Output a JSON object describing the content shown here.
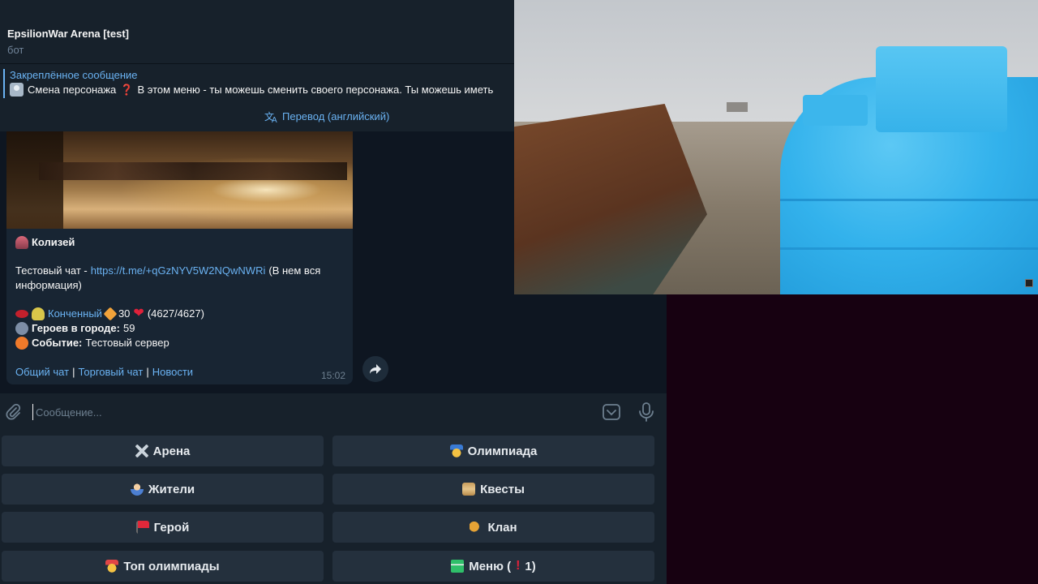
{
  "chat": {
    "title": "EpsilionWar Arena [test]",
    "status": "бот"
  },
  "pinned": {
    "title": "Закреплённое сообщение",
    "label": "Смена персонажа",
    "text": "В этом меню - ты можешь сменить своего персонажа. Ты можешь иметь"
  },
  "translate": {
    "label": "Перевод (английский)"
  },
  "message": {
    "location": "Колизей",
    "test_chat_label": "Тестовый чат - ",
    "test_chat_link": "https://t.me/+qGzNYV5W2NQwNWRi",
    "test_chat_note": " (В нем вся",
    "test_chat_note2": "информация)",
    "player_name": "Конченный",
    "level": "30",
    "hp": "(4627/4627)",
    "heroes_label": "Героев в городе:",
    "heroes_count": "59",
    "event_label": "Событие:",
    "event_value": "Тестовый сервер",
    "links": [
      "Общий чат",
      "Торговый чат",
      "Новости"
    ],
    "time": "15:02"
  },
  "composer": {
    "placeholder": "Сообщение..."
  },
  "keyboard": {
    "buttons": [
      {
        "label": "Арена",
        "icon": "crossed-swords-icon"
      },
      {
        "label": "Олимпиада",
        "icon": "medal-icon"
      },
      {
        "label": "Жители",
        "icon": "resident-icon"
      },
      {
        "label": "Квесты",
        "icon": "scroll-icon"
      },
      {
        "label": "Герой",
        "icon": "flag-icon"
      },
      {
        "label": "Клан",
        "icon": "horn-icon"
      },
      {
        "label": "Топ олимпиады",
        "icon": "medal-icon"
      },
      {
        "label": "Меню (",
        "icon": "menu-icon",
        "suffix": "1)"
      }
    ]
  },
  "colors": {
    "accent": "#6ab2f2",
    "chat_bg": "#0e1621",
    "panel_bg": "#17212b",
    "button_bg": "#24303d",
    "page_bg": "#170111"
  }
}
